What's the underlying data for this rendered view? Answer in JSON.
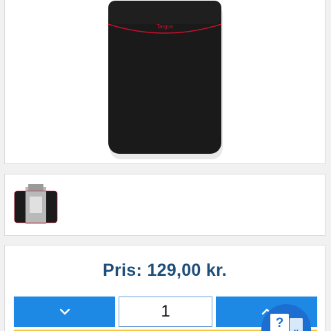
{
  "product": {
    "image_icon": "laptop-sleeve-image",
    "brand_text": "Targus",
    "brand_color": "#c8102e",
    "thumbnail_icon": "laptop-sleeve-thumbnail"
  },
  "price": {
    "label": "Pris:",
    "value": "129,00 kr.",
    "color": "#1f4e79"
  },
  "quantity": {
    "value": "1",
    "decrease_icon": "chevron-down-icon",
    "increase_icon": "chevron-up-icon",
    "button_color": "#1e88e5"
  },
  "help": {
    "icon": "help-chat-icon",
    "symbol": "?",
    "dots": ".."
  }
}
